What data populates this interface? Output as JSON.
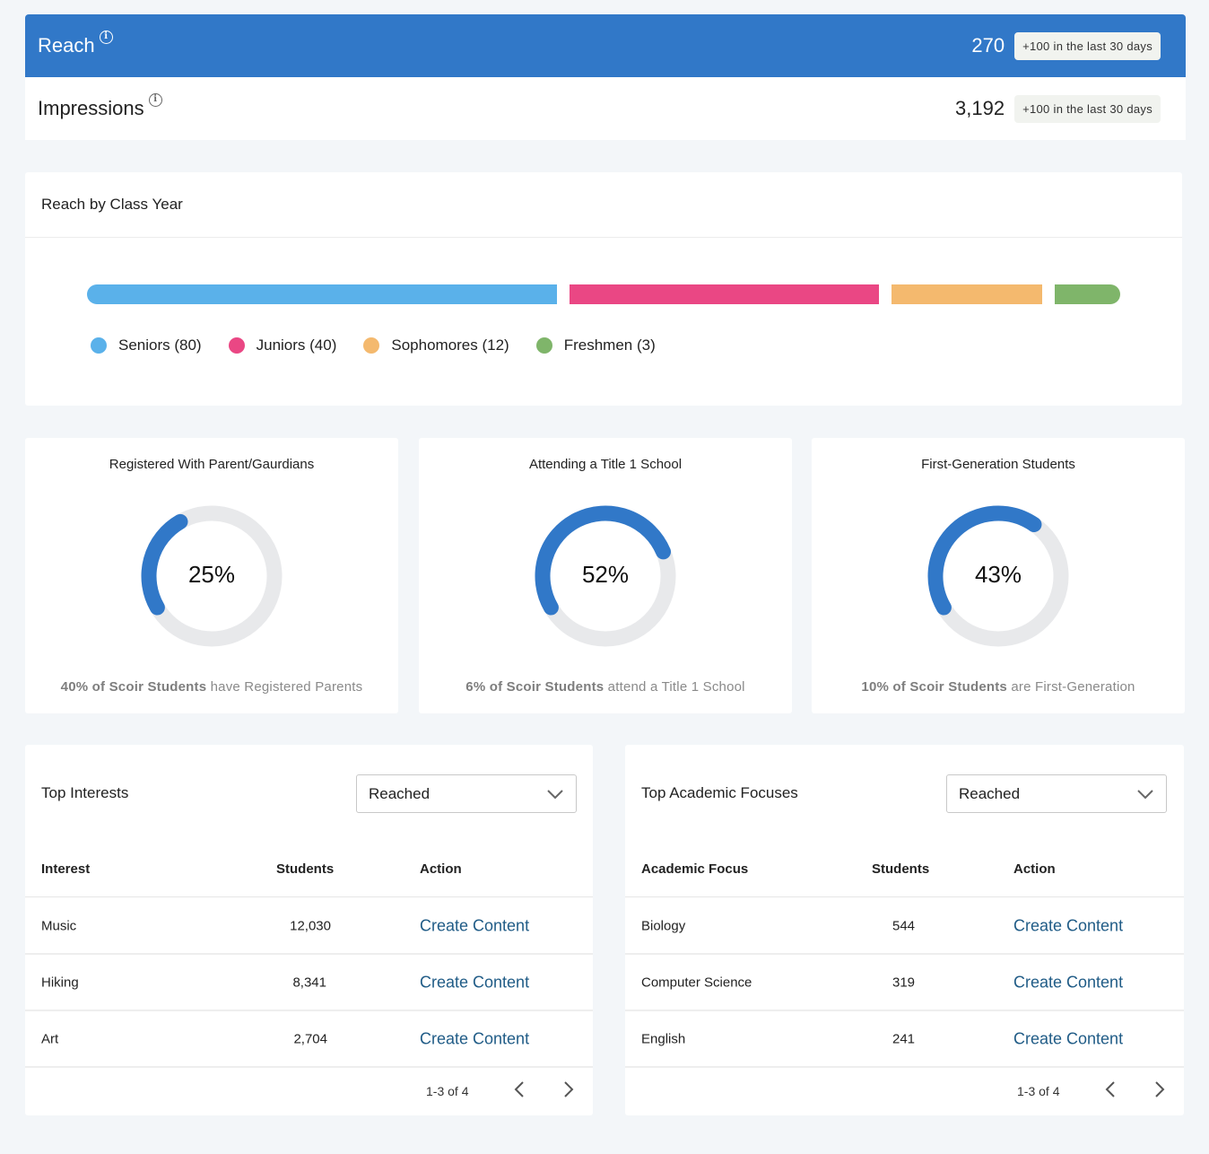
{
  "metrics": {
    "reach": {
      "label": "Reach",
      "value": "270",
      "delta": "+100 in the last 30 days",
      "info_icon": "info-icon"
    },
    "impressions": {
      "label": "Impressions",
      "value": "3,192",
      "delta": "+100 in the last 30 days",
      "info_icon": "info-icon"
    }
  },
  "class_year": {
    "title": "Reach by Class Year",
    "chart_data": {
      "type": "bar",
      "title": "Reach by Class Year",
      "categories": [
        "Seniors",
        "Juniors",
        "Sophomores",
        "Freshmen"
      ],
      "values": [
        80,
        40,
        12,
        3
      ],
      "colors": [
        "#5ab1ea",
        "#ea4784",
        "#f4b96e",
        "#7fb56a"
      ],
      "legend": [
        "Seniors (80)",
        "Juniors (40)",
        "Sophomores (12)",
        "Freshmen (3)"
      ],
      "legend_position": "bottom-left",
      "stacked": true
    }
  },
  "stats": [
    {
      "title": "Registered With Parent/Gaurdians",
      "percent": 25,
      "label": "25%",
      "caption_bold": "40% of Scoir Students",
      "caption_rest": " have Registered Parents"
    },
    {
      "title": "Attending a Title 1 School",
      "percent": 52,
      "label": "52%",
      "caption_bold": "6% of Scoir Students",
      "caption_rest": " attend a Title 1 School"
    },
    {
      "title": "First-Generation Students",
      "percent": 43,
      "label": "43%",
      "caption_bold": "10% of Scoir Students",
      "caption_rest": " are First-Generation"
    }
  ],
  "colors": {
    "accent": "#3178c8",
    "ring_track": "#e8e9eb",
    "link": "#1f5b86",
    "page_bg": "#f3f6f9"
  },
  "tables": [
    {
      "title": "Top Interests",
      "select_value": "Reached",
      "columns": [
        "Interest",
        "Students",
        "Action"
      ],
      "rows": [
        {
          "name": "Music",
          "students": "12,030",
          "action": "Create Content"
        },
        {
          "name": "Hiking",
          "students": "8,341",
          "action": "Create Content"
        },
        {
          "name": "Art",
          "students": "2,704",
          "action": "Create Content"
        }
      ],
      "pagination": "1-3 of 4"
    },
    {
      "title": "Top Academic Focuses",
      "select_value": "Reached",
      "columns": [
        "Academic Focus",
        "Students",
        "Action"
      ],
      "rows": [
        {
          "name": "Biology",
          "students": "544",
          "action": "Create Content"
        },
        {
          "name": "Computer Science",
          "students": "319",
          "action": "Create Content"
        },
        {
          "name": "English",
          "students": "241",
          "action": "Create Content"
        }
      ],
      "pagination": "1-3 of 4"
    }
  ]
}
